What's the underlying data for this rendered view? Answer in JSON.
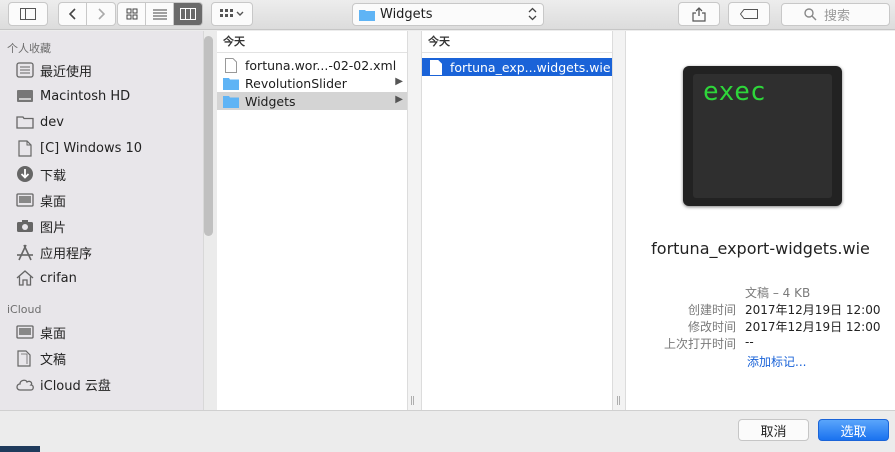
{
  "toolbar": {
    "path_label": "Widgets",
    "search_placeholder": "搜索"
  },
  "sidebar": {
    "favorites_header": "个人收藏",
    "favorites": [
      {
        "label": "最近使用",
        "icon": "recents-icon"
      },
      {
        "label": "Macintosh HD",
        "icon": "harddrive-icon"
      },
      {
        "label": "dev",
        "icon": "folder-icon"
      },
      {
        "label": "[C] Windows 10",
        "icon": "document-icon"
      },
      {
        "label": "下载",
        "icon": "download-icon"
      },
      {
        "label": "桌面",
        "icon": "desktop-icon"
      },
      {
        "label": "图片",
        "icon": "camera-icon"
      },
      {
        "label": "应用程序",
        "icon": "applications-icon"
      },
      {
        "label": "crifan",
        "icon": "home-icon"
      }
    ],
    "icloud_header": "iCloud",
    "icloud": [
      {
        "label": "桌面",
        "icon": "desktop-icon"
      },
      {
        "label": "文稿",
        "icon": "document-icon"
      },
      {
        "label": "iCloud 云盘",
        "icon": "cloud-icon"
      }
    ]
  },
  "column1": {
    "header": "今天",
    "rows": [
      {
        "label": "fortuna.wor...-02-02.xml",
        "type": "file"
      },
      {
        "label": "RevolutionSlider",
        "type": "folder"
      },
      {
        "label": "Widgets",
        "type": "folder"
      }
    ]
  },
  "column2": {
    "header": "今天",
    "rows": [
      {
        "label": "fortuna_exp...widgets.wie",
        "type": "file"
      }
    ]
  },
  "preview": {
    "icon_text": "exec",
    "filename": "fortuna_export-widgets.wie",
    "kind_size": "文稿 – 4 KB",
    "created_label": "创建时间",
    "created_value": "2017年12月19日 12:00",
    "modified_label": "修改时间",
    "modified_value": "2017年12月19日 12:00",
    "last_opened_label": "上次打开时间",
    "last_opened_value": "--",
    "add_tags": "添加标记..."
  },
  "buttons": {
    "cancel": "取消",
    "choose": "选取"
  },
  "colors": {
    "selection_blue": "#1a63d8",
    "folder_blue": "#5fb4f5",
    "terminal_green": "#2ed63a"
  }
}
